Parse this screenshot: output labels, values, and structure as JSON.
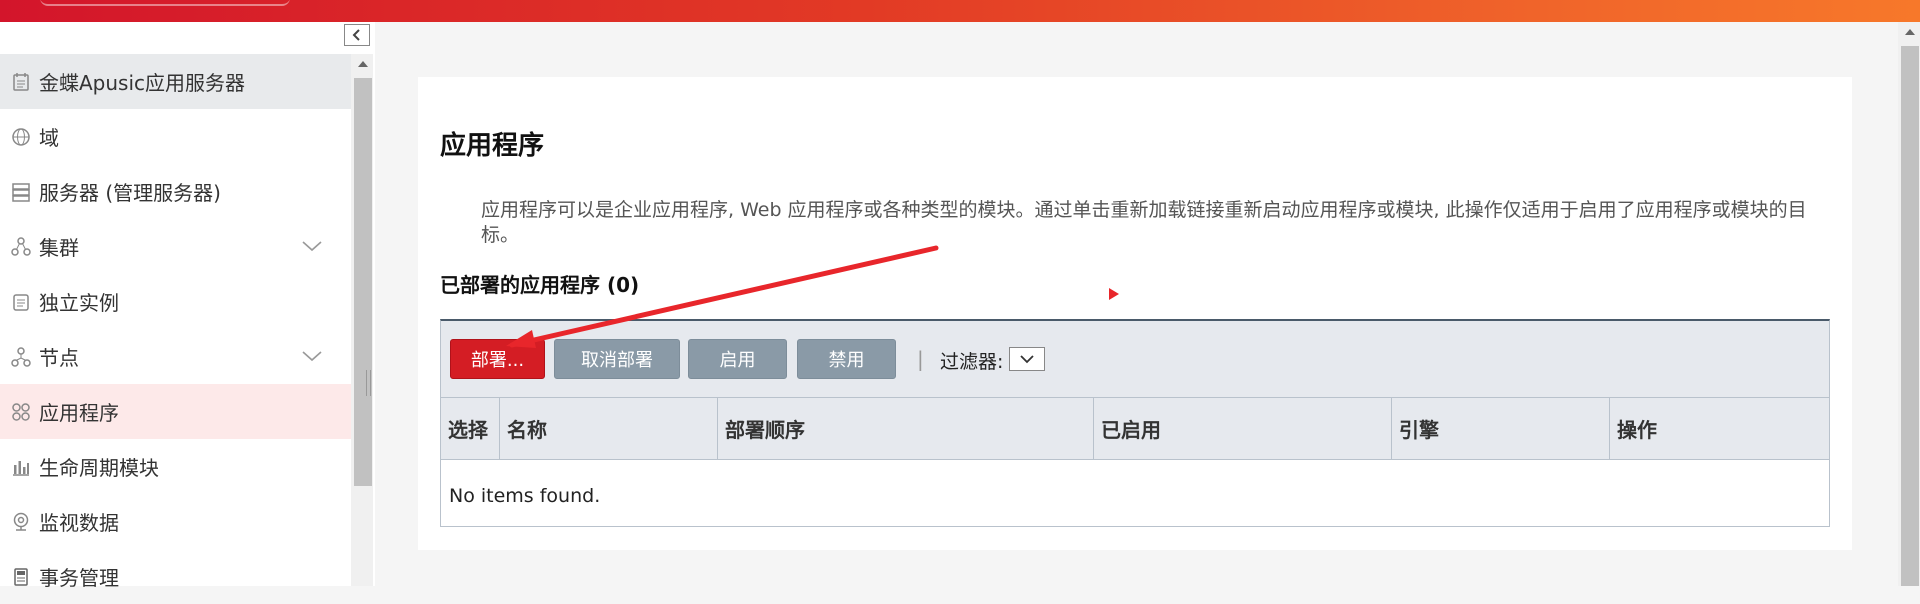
{
  "sidebar": {
    "items": [
      {
        "label": "金蝶Apusic应用服务器",
        "icon": "server-tree-icon"
      },
      {
        "label": "域",
        "icon": "globe-icon"
      },
      {
        "label": "服务器 (管理服务器)",
        "icon": "server-rack-icon"
      },
      {
        "label": "集群",
        "icon": "cluster-icon",
        "expandable": true
      },
      {
        "label": "独立实例",
        "icon": "instance-icon"
      },
      {
        "label": "节点",
        "icon": "node-icon",
        "expandable": true
      },
      {
        "label": "应用程序",
        "icon": "applications-icon",
        "selected": true
      },
      {
        "label": "生命周期模块",
        "icon": "lifecycle-chart-icon"
      },
      {
        "label": "监视数据",
        "icon": "monitor-icon"
      },
      {
        "label": "事务管理",
        "icon": "transaction-icon"
      }
    ]
  },
  "main": {
    "title": "应用程序",
    "description": "应用程序可以是企业应用程序, Web 应用程序或各种类型的模块。通过单击重新加载链接重新启动应用程序或模块, 此操作仅适用于启用了应用程序或模块的目标。",
    "section_title": "已部署的应用程序 (0)",
    "toolbar": {
      "deploy": "部署...",
      "undeploy": "取消部署",
      "enable": "启用",
      "disable": "禁用",
      "separator": "|",
      "filter_label": "过滤器:"
    },
    "columns": [
      "选择",
      "名称",
      "部署顺序",
      "已启用",
      "引擎",
      "操作"
    ],
    "empty_message": "No items found."
  },
  "colors": {
    "brand_red": "#d41d24",
    "gradient_start": "#d3152b",
    "gradient_end": "#f7782a",
    "selected_bg": "#fde9e9",
    "button_gray": "#8a9aa7"
  }
}
